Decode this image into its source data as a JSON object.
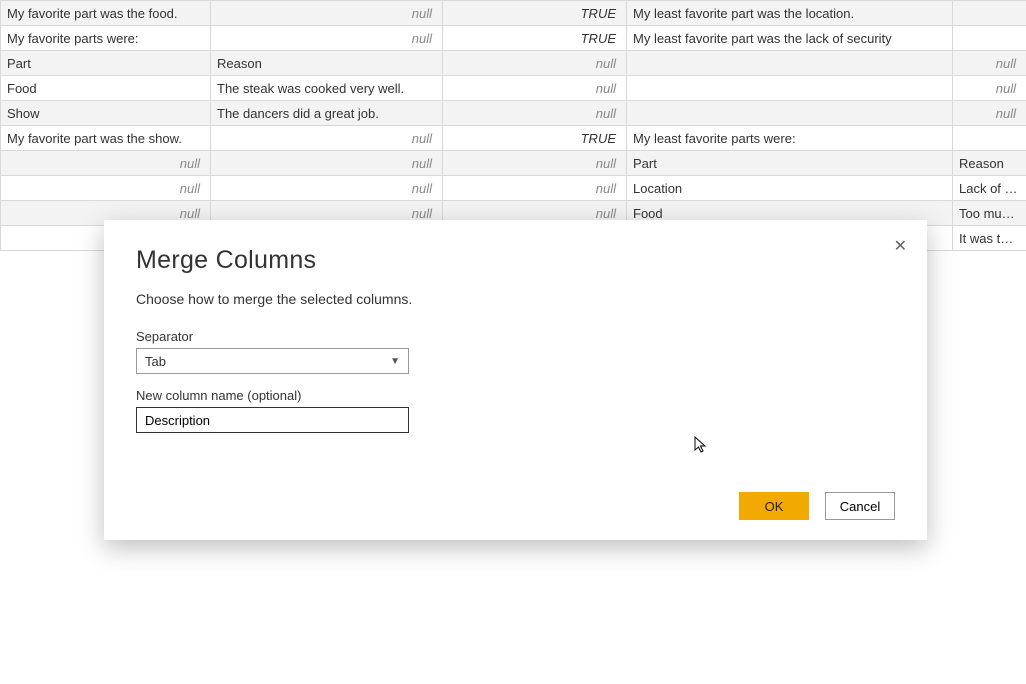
{
  "null_label": "null",
  "true_label": "TRUE",
  "table": {
    "rows": [
      {
        "c0": "My favorite part was the food.",
        "c1": null,
        "c2": "TRUE",
        "c3": "My least favorite part was the location.",
        "c4": ""
      },
      {
        "c0": "My favorite parts were:",
        "c1": null,
        "c2": "TRUE",
        "c3": "My least favorite part was  the lack of security",
        "c4": ""
      },
      {
        "c0": "Part",
        "c1": "Reason",
        "c2": null,
        "c3": "",
        "c4": null
      },
      {
        "c0": "Food",
        "c1": "The steak was cooked very well.",
        "c2": null,
        "c3": "",
        "c4": null
      },
      {
        "c0": "Show",
        "c1": "The dancers did a great job.",
        "c2": null,
        "c3": "",
        "c4": null
      },
      {
        "c0": "My favorite part was the show.",
        "c1": null,
        "c2": "TRUE",
        "c3": "My least favorite parts were:",
        "c4": ""
      },
      {
        "c0": null,
        "c1": null,
        "c2": null,
        "c3": "Part",
        "c4": "Reason"
      },
      {
        "c0": null,
        "c1": null,
        "c2": null,
        "c3": "Location",
        "c4": "Lack of security"
      },
      {
        "c0": null,
        "c1": null,
        "c2": null,
        "c3": "Food",
        "c4": "Too much salt"
      },
      {
        "c0": "",
        "c1": "",
        "c2": "",
        "c3": "",
        "c4": "It was too cold"
      }
    ]
  },
  "dialog": {
    "title": "Merge Columns",
    "description": "Choose how to merge the selected columns.",
    "separator_label": "Separator",
    "separator_value": "Tab",
    "new_name_label": "New column name (optional)",
    "new_name_value": "Description",
    "ok_label": "OK",
    "cancel_label": "Cancel"
  }
}
